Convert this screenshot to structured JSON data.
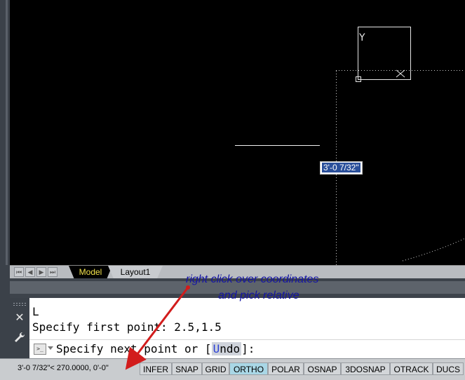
{
  "drawing": {
    "dynamic_input_value": "3'-0 7/32\"",
    "ucs_label": "Y"
  },
  "layout_tabs": [
    {
      "label": "Model",
      "active": true
    },
    {
      "label": "Layout1",
      "active": false
    }
  ],
  "command_line": {
    "history": [
      "L",
      "Specify first point: 2.5,1.5"
    ],
    "prompt_before": "Specify next point or [",
    "keyword_key": "U",
    "keyword_rest": "ndo",
    "prompt_after": "]:"
  },
  "status_bar": {
    "coordinates": "3'-0 7/32\"< 270.0000, 0'-0\"",
    "buttons": [
      {
        "label": "INFER",
        "active": false
      },
      {
        "label": "SNAP",
        "active": false
      },
      {
        "label": "GRID",
        "active": false
      },
      {
        "label": "ORTHO",
        "active": true
      },
      {
        "label": "POLAR",
        "active": false
      },
      {
        "label": "OSNAP",
        "active": false
      },
      {
        "label": "3DOSNAP",
        "active": false
      },
      {
        "label": "OTRACK",
        "active": false
      },
      {
        "label": "DUCS",
        "active": false
      }
    ]
  },
  "annotation": {
    "line1": "right click over coordinates",
    "line2": "and pick relative",
    "color": "#1515a5",
    "arrow_color": "#d21c1c"
  },
  "colors": {
    "model_tab_text": "#f2e24b",
    "ortho_active": "#a9d7e6",
    "undo_key": "#2b3fd6"
  }
}
